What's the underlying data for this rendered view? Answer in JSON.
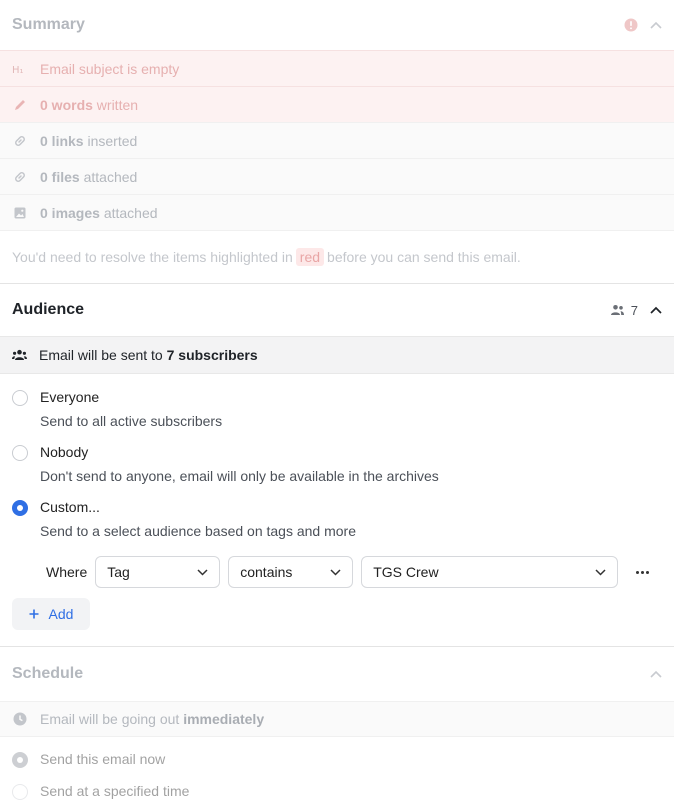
{
  "summary": {
    "title": "Summary",
    "rows": [
      {
        "icon": "heading-icon",
        "bold": "",
        "text": "Email subject is empty"
      },
      {
        "icon": "pencil-icon",
        "bold": "0 words",
        "text": "written"
      },
      {
        "icon": "link-icon",
        "bold": "0 links",
        "text": "inserted"
      },
      {
        "icon": "link-icon",
        "bold": "0 files",
        "text": "attached"
      },
      {
        "icon": "image-icon",
        "bold": "0 images",
        "text": "attached"
      }
    ],
    "note_before": "You'd need to resolve the items highlighted in",
    "note_highlight": "red",
    "note_after": "before you can send this email."
  },
  "audience": {
    "title": "Audience",
    "count": "7",
    "banner_prefix": "Email will be sent to",
    "banner_bold": "7 subscribers",
    "options": [
      {
        "label": "Everyone",
        "desc": "Send to all active subscribers",
        "selected": false
      },
      {
        "label": "Nobody",
        "desc": "Don't send to anyone, email will only be available in the archives",
        "selected": false
      },
      {
        "label": "Custom...",
        "desc": "Send to a select audience based on tags and more",
        "selected": true
      }
    ],
    "filter": {
      "where": "Where",
      "field": "Tag",
      "operator": "contains",
      "value": "TGS Crew"
    },
    "add_label": "Add"
  },
  "schedule": {
    "title": "Schedule",
    "banner_prefix": "Email will be going out",
    "banner_bold": "immediately",
    "options": [
      {
        "label": "Send this email now",
        "selected": true
      },
      {
        "label": "Send at a specified time",
        "selected": false
      }
    ]
  },
  "colors": {
    "accent": "#2f6fe4",
    "error_bg": "#fdf2f2",
    "error_icon": "#e9a6a6"
  }
}
